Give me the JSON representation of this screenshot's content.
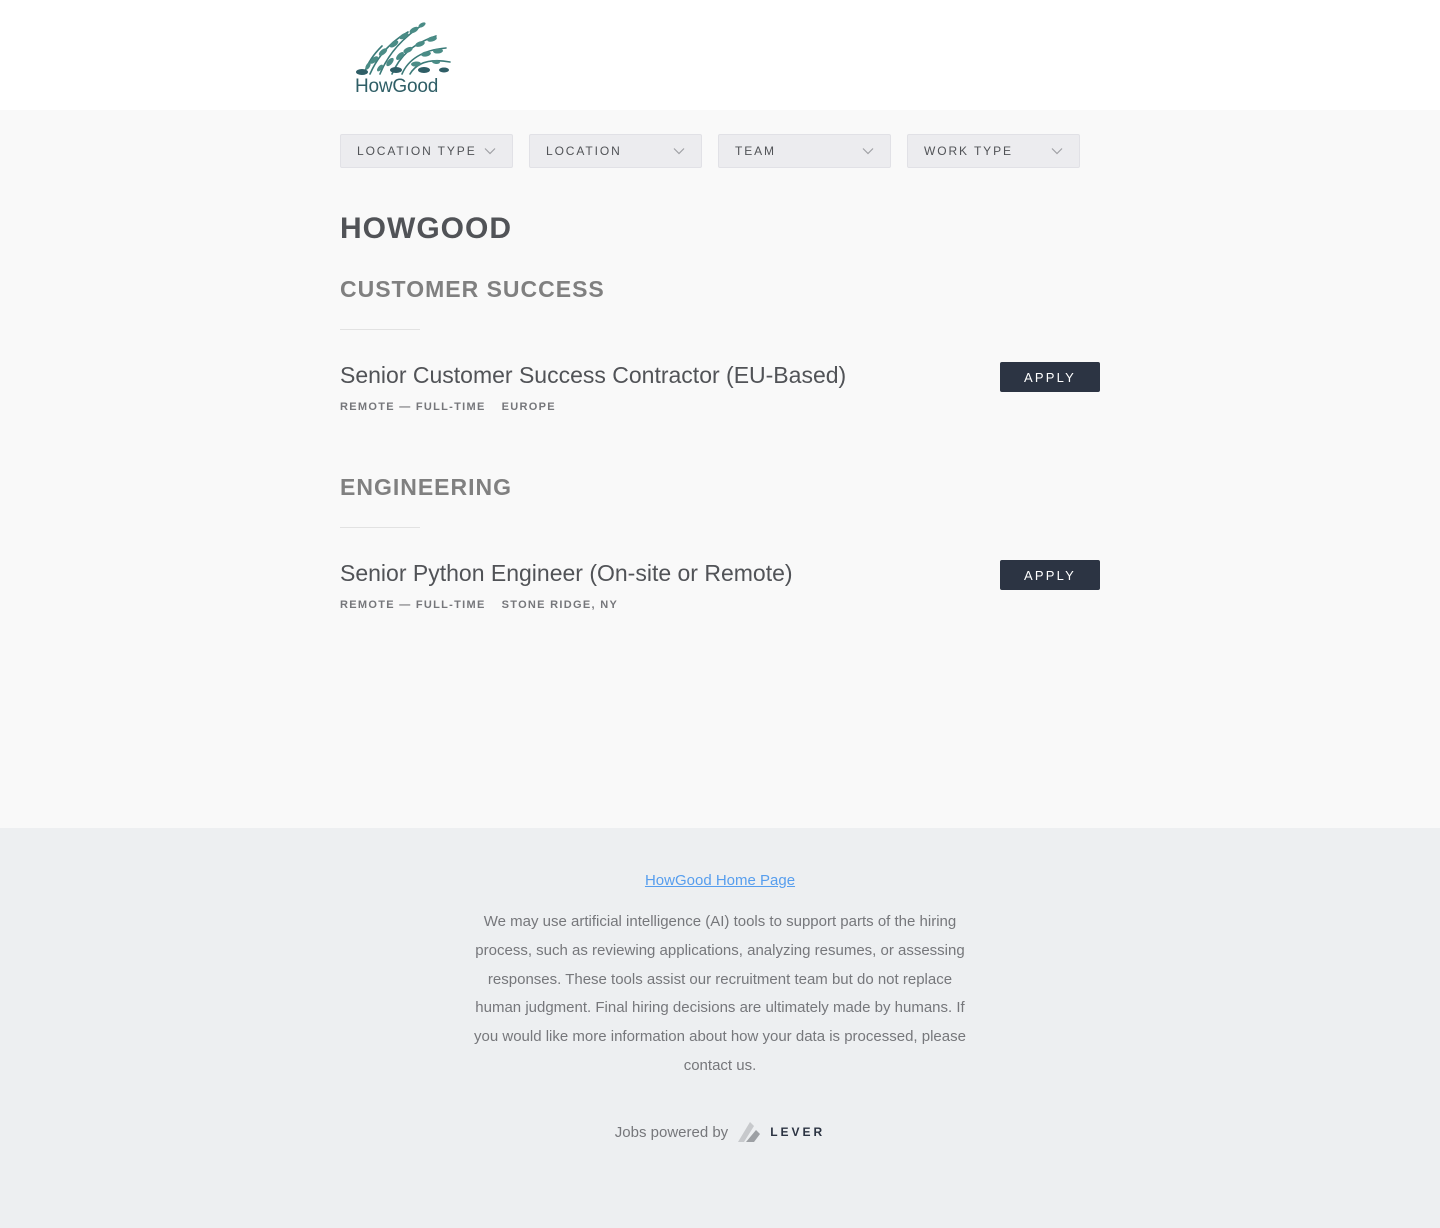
{
  "header": {
    "logo_text": "HowGood",
    "logo_icon": "leaf-bundle-logo"
  },
  "filters": [
    {
      "label": "LOCATION TYPE"
    },
    {
      "label": "LOCATION"
    },
    {
      "label": "TEAM"
    },
    {
      "label": "WORK TYPE"
    }
  ],
  "company_name": "HOWGOOD",
  "groups": [
    {
      "title": "CUSTOMER SUCCESS",
      "postings": [
        {
          "title": "Senior Customer Success Contractor (EU-Based)",
          "commitment": "REMOTE — FULL-TIME",
          "location": "EUROPE",
          "apply_label": "APPLY"
        }
      ]
    },
    {
      "title": "ENGINEERING",
      "postings": [
        {
          "title": "Senior Python Engineer (On-site or Remote)",
          "commitment": "REMOTE — FULL-TIME",
          "location": "STONE RIDGE, NY",
          "apply_label": "APPLY"
        }
      ]
    }
  ],
  "footer": {
    "home_link": "HowGood Home Page",
    "note": "We may use artificial intelligence (AI) tools to support parts of the hiring process, such as reviewing applications, analyzing resumes, or assessing responses. These tools assist our recruitment team but do not replace human judgment. Final hiring decisions are ultimately made by humans. If you would like more information about how your data is processed, please contact us.",
    "powered_by": "Jobs powered by",
    "lever_word": "LEVER"
  },
  "colors": {
    "apply_button": "#2c3443",
    "link": "#579eee",
    "logo_green": "#2f5e66"
  }
}
